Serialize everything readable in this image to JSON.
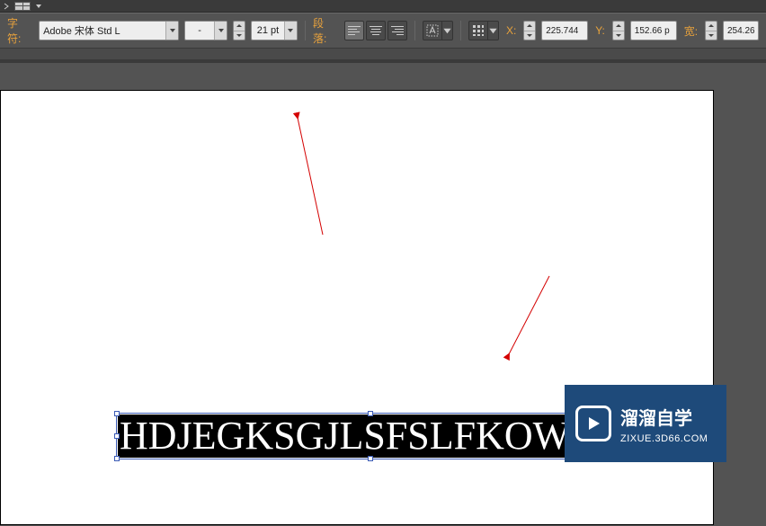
{
  "toolbar": {
    "char_label": "字符:",
    "font_family": "Adobe 宋体 Std L",
    "font_style": "-",
    "font_size": "21 pt",
    "para_label": "段落:",
    "coords": {
      "x_label": "X:",
      "x_value": "225.744",
      "y_label": "Y:",
      "y_value": "152.66 p",
      "w_label": "宽:",
      "w_value": "254.26"
    }
  },
  "canvas": {
    "text_content": "HDJEGKSGJLSFSLFKOWEJF"
  },
  "watermark": {
    "title": "溜溜自学",
    "url": "ZIXUE.3D66.COM"
  }
}
